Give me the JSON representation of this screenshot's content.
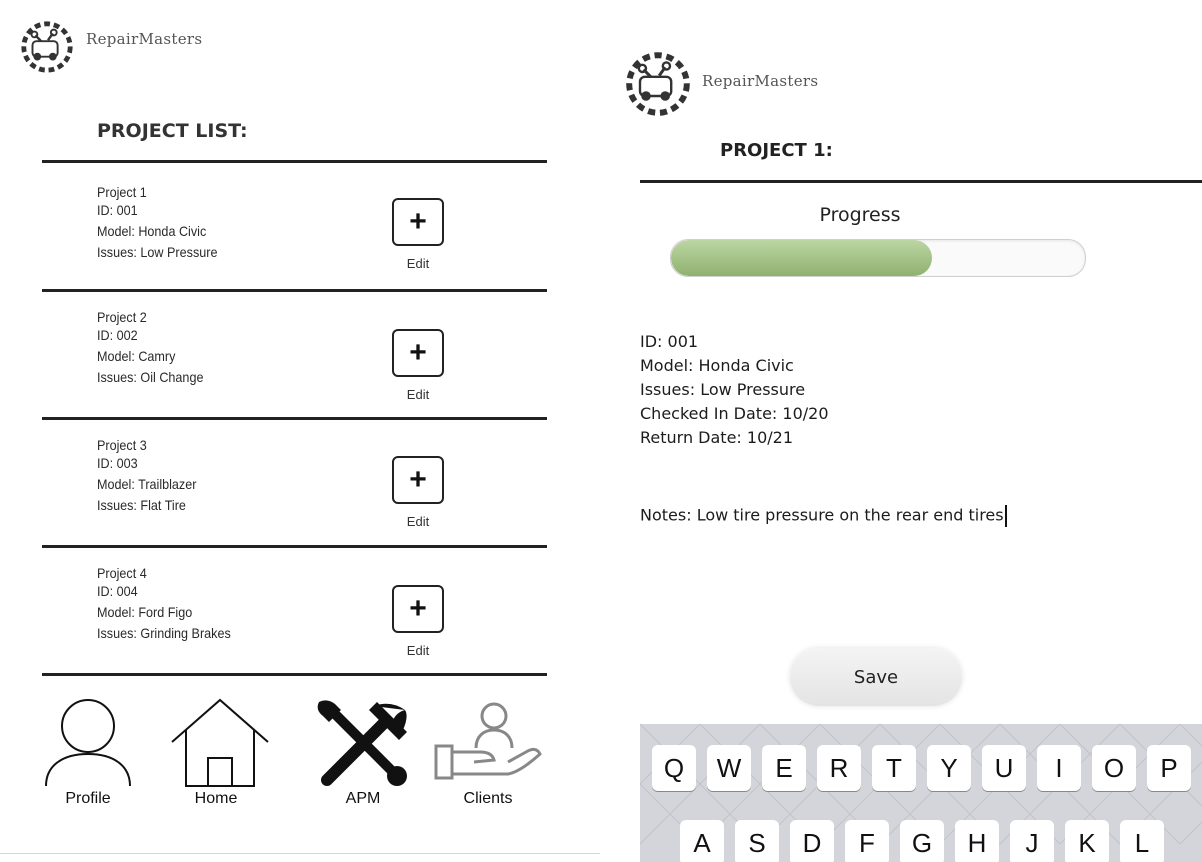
{
  "brand": {
    "name": "RepairMasters",
    "logo_icon": "gear-car-logo-icon"
  },
  "left_screen": {
    "title": "PROJECT LIST:",
    "projects": [
      {
        "name": "Project 1",
        "id": "ID: 001",
        "model": "Model: Honda Civic",
        "issues": "Issues: Low Pressure",
        "edit_icon": "+",
        "edit_label": "Edit"
      },
      {
        "name": "Project 2",
        "id": "ID: 002",
        "model": "Model: Camry",
        "issues": "Issues: Oil Change",
        "edit_icon": "+",
        "edit_label": "Edit"
      },
      {
        "name": "Project 3",
        "id": "ID: 003",
        "model": "Model: Trailblazer",
        "issues": "Issues: Flat Tire",
        "edit_icon": "+",
        "edit_label": "Edit"
      },
      {
        "name": "Project 4",
        "id": "ID: 004",
        "model": "Model: Ford Figo",
        "issues": "Issues: Grinding Brakes",
        "edit_icon": "+",
        "edit_label": "Edit"
      }
    ],
    "nav": [
      {
        "label": "Profile",
        "icon": "person-icon"
      },
      {
        "label": "Home",
        "icon": "house-icon"
      },
      {
        "label": "APM",
        "icon": "tools-icon"
      },
      {
        "label": "Clients",
        "icon": "hand-person-icon"
      }
    ]
  },
  "right_screen": {
    "title": "PROJECT 1:",
    "progress_label": "Progress",
    "progress_fraction": 0.63,
    "details": {
      "id": "ID: 001",
      "model": "Model: Honda Civic",
      "issues": "Issues: Low Pressure",
      "checked_in": "Checked In Date: 10/20",
      "return_date": "Return Date: 10/21"
    },
    "notes": "Notes: Low tire pressure on the rear end tires",
    "save_label": "Save",
    "keyboard": {
      "row1": [
        "Q",
        "W",
        "E",
        "R",
        "T",
        "Y",
        "U",
        "I",
        "O",
        "P"
      ],
      "row2": [
        "A",
        "S",
        "D",
        "F",
        "G",
        "H",
        "J",
        "K",
        "L"
      ]
    }
  },
  "colors": {
    "progress_fill": "#9fbf83",
    "keyboard_bg": "#d3d5da",
    "divider": "#222222"
  }
}
